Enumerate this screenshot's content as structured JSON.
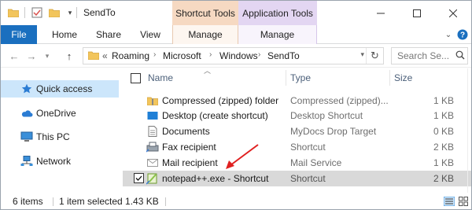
{
  "window": {
    "title": "SendTo",
    "context_tabs": [
      "Shortcut Tools",
      "Application Tools"
    ]
  },
  "ribbon": {
    "tabs": [
      "File",
      "Home",
      "Share",
      "View",
      "Manage",
      "Manage"
    ]
  },
  "address": {
    "overflow": "«",
    "crumbs": [
      "Roaming",
      "Microsoft",
      "Windows",
      "SendTo"
    ]
  },
  "search": {
    "placeholder": "Search Se..."
  },
  "nav_pane": {
    "items": [
      {
        "label": "Quick access",
        "icon": "star-icon",
        "selected": true
      },
      {
        "label": "OneDrive",
        "icon": "cloud-icon"
      },
      {
        "label": "This PC",
        "icon": "computer-icon"
      },
      {
        "label": "Network",
        "icon": "network-icon"
      }
    ]
  },
  "columns": {
    "name": "Name",
    "type": "Type",
    "size": "Size"
  },
  "files": [
    {
      "name": "Compressed (zipped) folder",
      "type": "Compressed (zipped)...",
      "size": "1 KB",
      "icon": "zip-folder-icon"
    },
    {
      "name": "Desktop (create shortcut)",
      "type": "Desktop Shortcut",
      "size": "1 KB",
      "icon": "desktop-icon"
    },
    {
      "name": "Documents",
      "type": "MyDocs Drop Target",
      "size": "0 KB",
      "icon": "documents-icon"
    },
    {
      "name": "Fax recipient",
      "type": "Shortcut",
      "size": "2 KB",
      "icon": "fax-icon"
    },
    {
      "name": "Mail recipient",
      "type": "Mail Service",
      "size": "1 KB",
      "icon": "mail-icon"
    },
    {
      "name": "notepad++.exe - Shortcut",
      "type": "Shortcut",
      "size": "2 KB",
      "icon": "notepad-plus-plus-icon",
      "selected": true
    }
  ],
  "status": {
    "items": "6 items",
    "selected": "1 item selected  1.43 KB"
  },
  "colors": {
    "file_tab": "#1a6fbf",
    "shortcut_tools": "#f6d9c2",
    "application_tools": "#e3d6f2",
    "selected_nav": "#cce6fb",
    "selected_row": "#d9d9d9",
    "annotation_arrow": "#e02020"
  }
}
